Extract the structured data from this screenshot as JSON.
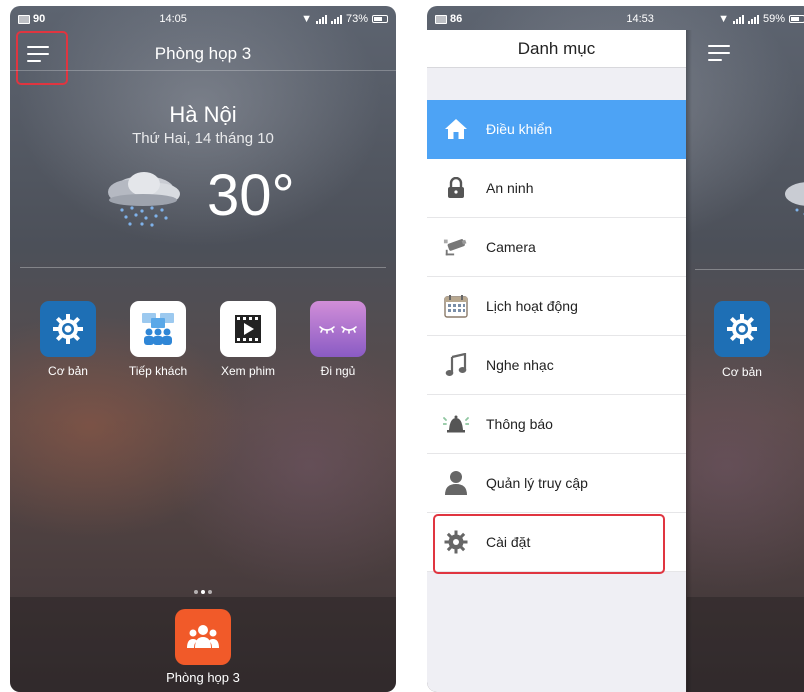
{
  "colors": {
    "accent_blue": "#4DA3F5",
    "highlight_red": "#E03540",
    "basic_scene_blue": "#1E6FB5",
    "dock_app_orange": "#F15A29"
  },
  "left_screen": {
    "status": {
      "notification_count": "90",
      "time": "14:05",
      "battery": "73%"
    },
    "header": {
      "title": "Phòng họp 3",
      "menu_icon": "hamburger-menu-icon"
    },
    "weather": {
      "city": "Hà Nội",
      "date": "Thứ Hai, 14 tháng 10",
      "temperature": "30°",
      "icon": "rain-cloud-icon"
    },
    "scenes": [
      {
        "label": "Cơ bản",
        "icon": "gear-icon"
      },
      {
        "label": "Tiếp khách",
        "icon": "meeting-icon"
      },
      {
        "label": "Xem phim",
        "icon": "film-icon"
      },
      {
        "label": "Đi ngủ",
        "icon": "sleep-eyes-icon"
      }
    ],
    "page_indicator": {
      "pages": 3,
      "current": 2
    },
    "dock": {
      "label": "Phòng họp 3",
      "icon": "group-icon"
    }
  },
  "right_screen": {
    "status": {
      "notification_count": "86",
      "time": "14:53",
      "battery": "59%"
    },
    "drawer": {
      "title": "Danh mục",
      "items": [
        {
          "label": "Điều khiển",
          "icon": "home-icon",
          "active": true
        },
        {
          "label": "An ninh",
          "icon": "lock-icon",
          "active": false
        },
        {
          "label": "Camera",
          "icon": "security-camera-icon",
          "active": false
        },
        {
          "label": "Lịch hoạt động",
          "icon": "calendar-icon",
          "active": false
        },
        {
          "label": "Nghe nhạc",
          "icon": "music-note-icon",
          "active": false
        },
        {
          "label": "Thông báo",
          "icon": "alarm-bell-icon",
          "active": false
        },
        {
          "label": "Quản lý truy cập",
          "icon": "user-icon",
          "active": false
        },
        {
          "label": "Cài đặt",
          "icon": "settings-gear-icon",
          "active": false
        }
      ]
    },
    "background_scene": {
      "label": "Cơ bản",
      "icon": "gear-icon"
    }
  }
}
